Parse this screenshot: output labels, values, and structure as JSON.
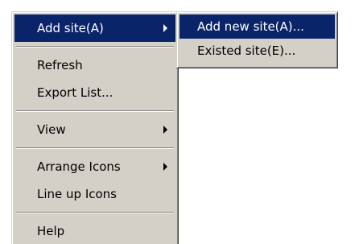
{
  "context_menu": {
    "items": [
      {
        "label": "Add site(A)",
        "has_submenu": true,
        "highlighted": true
      },
      {
        "label": "Refresh"
      },
      {
        "label": "Export List..."
      },
      {
        "label": "View",
        "has_submenu": true
      },
      {
        "label": "Arrange Icons",
        "has_submenu": true
      },
      {
        "label": "Line up Icons"
      },
      {
        "label": "Help"
      }
    ]
  },
  "submenu": {
    "items": [
      {
        "label": "Add new site(A)...",
        "highlighted": true
      },
      {
        "label": "Existed site(E)..."
      }
    ]
  },
  "colors": {
    "menu_background": "#d4d0c8",
    "highlight": "#0a246a",
    "highlight_text": "#ffffff"
  }
}
